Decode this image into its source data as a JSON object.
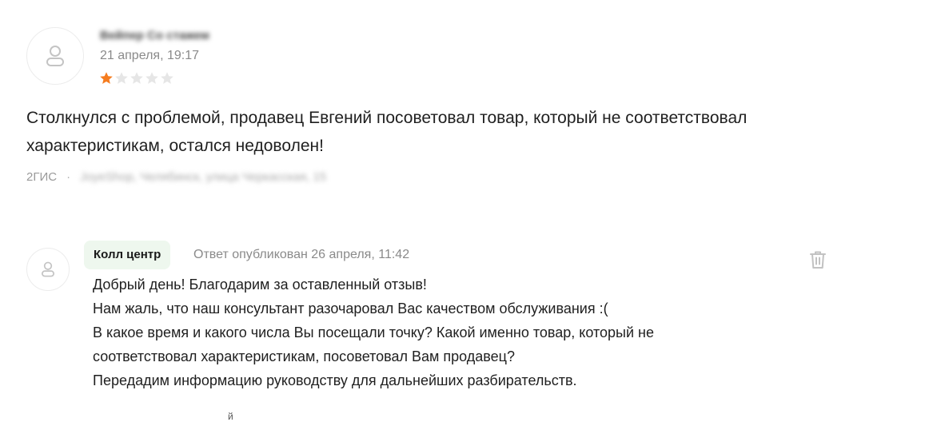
{
  "review": {
    "author": "Вейпер Со стажем",
    "date": "21 апреля, 19:17",
    "rating": 1,
    "rating_max": 5,
    "star_filled_color": "#f57c1f",
    "star_empty_color": "#e6e6e6",
    "text_lines": [
      "Столкнулся с проблемой, продавец Евгений посоветовал товар, который не соответствовал",
      "характеристикам, остался недоволен!"
    ],
    "source": "2ГИС",
    "separator": "·",
    "address": "JoyeShop, Челябинск, улица Черкасская, 15"
  },
  "reply": {
    "author_badge": "Колл центр",
    "meta": "Ответ опубликован 26 апреля, 11:42",
    "lines": [
      "Добрый день! Благодарим за оставленный отзыв!",
      "Нам жаль, что наш консультант разочаровал Вас качеством обслуживания :(",
      "В какое время и какого числа Вы посещали точку? Какой именно товар, который не",
      "соответствовал характеристикам, посоветовал Вам продавец?",
      "Передадим информацию руководству для дальнейших разбирательств."
    ],
    "delete_icon": "trash-icon"
  },
  "cutoff_char": "й"
}
